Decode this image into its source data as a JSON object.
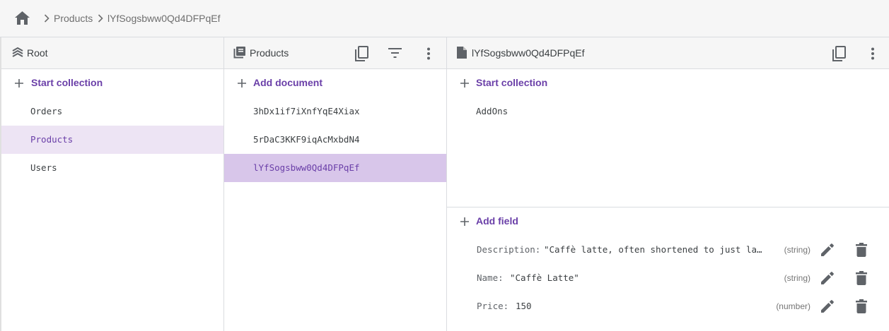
{
  "breadcrumb": {
    "items": [
      "Products",
      "lYfSogsbww0Qd4DFPqEf"
    ]
  },
  "root_panel": {
    "title": "Root",
    "start_collection": "Start collection",
    "collections": [
      "Orders",
      "Products",
      "Users"
    ]
  },
  "products_panel": {
    "title": "Products",
    "add_document": "Add document",
    "documents": [
      "3hDx1if7iXnfYqE4Xiax",
      "5rDaC3KKF9iqAcMxbdN4",
      "lYfSogsbww0Qd4DFPqEf"
    ]
  },
  "document_panel": {
    "title": "lYfSogsbww0Qd4DFPqEf",
    "start_collection": "Start collection",
    "subcollections": [
      "AddOns"
    ],
    "add_field": "Add field",
    "fields": [
      {
        "key": "Description:",
        "value": "\"Caffè latte, often shortened to just la…",
        "type": "(string)"
      },
      {
        "key": "Name:",
        "value": "\"Caffè Latte\"",
        "type": "(string)"
      },
      {
        "key": "Price:",
        "value": "150",
        "type": "(number)"
      }
    ]
  },
  "colors": {
    "accent": "#6a3fa8",
    "selected_light": "#ede4f4",
    "selected_dark": "#d8c6ea",
    "header_bg": "#f6f6f6"
  }
}
